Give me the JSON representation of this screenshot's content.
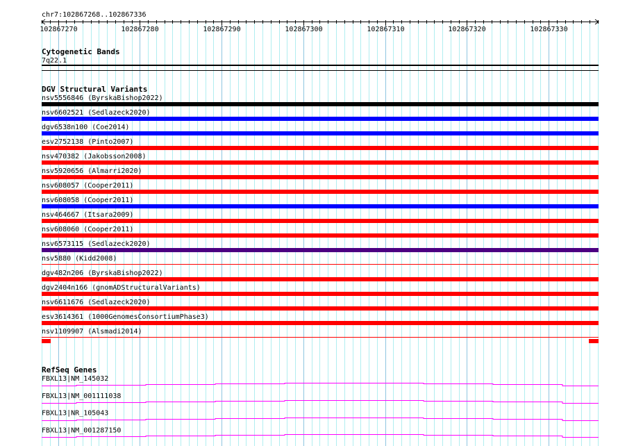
{
  "ruler": {
    "region": "chr7:102867268..102867336",
    "start": 102867268,
    "end": 102867336,
    "major_ticks": [
      "102867270",
      "102867280",
      "102867290",
      "102867300",
      "102867310",
      "102867320",
      "102867330"
    ]
  },
  "cytobands": {
    "title": "Cytogenetic Bands",
    "band": "7q22.1"
  },
  "dgv": {
    "title": "DGV Structural Variants",
    "items": [
      {
        "label": "nsv5556846 (ByrskaBishop2022)",
        "color": "#000000",
        "style": "bar"
      },
      {
        "label": "nsv6602521 (Sedlazeck2020)",
        "color": "#0000ff",
        "style": "bar"
      },
      {
        "label": "dgv6538n100 (Coe2014)",
        "color": "#0000ff",
        "style": "bar"
      },
      {
        "label": "esv2752138 (Pinto2007)",
        "color": "#ff0000",
        "style": "bar"
      },
      {
        "label": "nsv470382 (Jakobsson2008)",
        "color": "#ff0000",
        "style": "bar"
      },
      {
        "label": "nsv5920656 (Almarri2020)",
        "color": "#ff0000",
        "style": "bar"
      },
      {
        "label": "nsv608057 (Cooper2011)",
        "color": "#ff0000",
        "style": "bar"
      },
      {
        "label": "nsv608058 (Cooper2011)",
        "color": "#0000ff",
        "style": "bar"
      },
      {
        "label": "nsv464667 (Itsara2009)",
        "color": "#ff0000",
        "style": "bar"
      },
      {
        "label": "nsv608060 (Cooper2011)",
        "color": "#ff0000",
        "style": "bar"
      },
      {
        "label": "nsv6573115 (Sedlazeck2020)",
        "color": "#4b0082",
        "style": "bar"
      },
      {
        "label": "nsv5880 (Kidd2008)",
        "color": "#ff0000",
        "style": "line"
      },
      {
        "label": "dgv482n206 (ByrskaBishop2022)",
        "color": "#ff0000",
        "style": "bar"
      },
      {
        "label": "dgv2404n166 (gnomADStructuralVariants)",
        "color": "#ff0000",
        "style": "bar"
      },
      {
        "label": "nsv6611676 (Sedlazeck2020)",
        "color": "#ff0000",
        "style": "bar"
      },
      {
        "label": "esv3614361 (1000GenomesConsortiumPhase3)",
        "color": "#ff0000",
        "style": "bar"
      },
      {
        "label": "nsv1109907 (Alsmadi2014)",
        "color": "#ff0000",
        "style": "ends"
      }
    ]
  },
  "refseq": {
    "title": "RefSeq Genes",
    "color": "#ff00ff",
    "genes": [
      {
        "label": "FBXL13|NM_145032"
      },
      {
        "label": "FBXL13|NM_001111038"
      },
      {
        "label": "FBXL13|NR_105043"
      },
      {
        "label": "FBXL13|NM_001287150"
      }
    ]
  }
}
